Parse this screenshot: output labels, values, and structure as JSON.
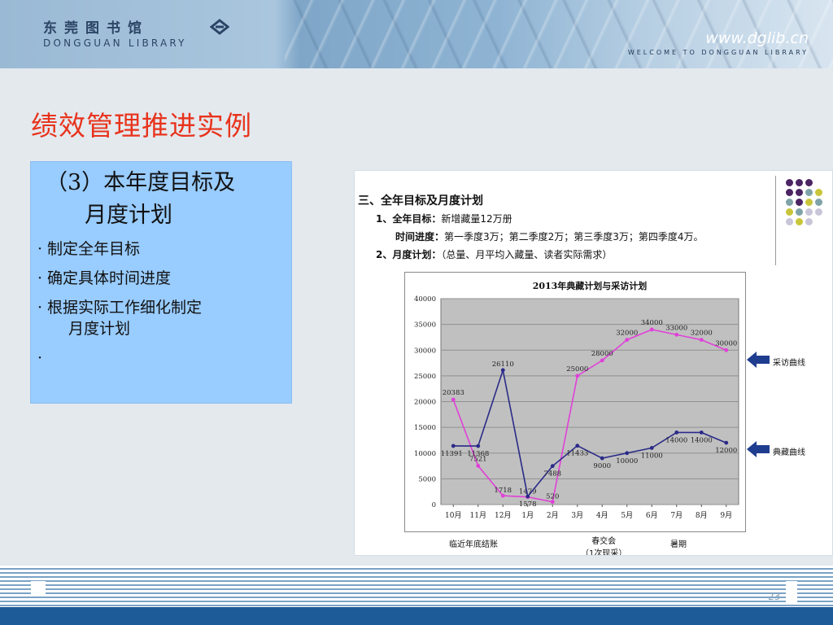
{
  "header": {
    "logo_cn": "东莞图书馆",
    "logo_en": "DONGGUAN LIBRARY",
    "site_url": "www.dglib.cn",
    "site_tagline": "WELCOME TO DONGGUAN LIBRARY"
  },
  "slide": {
    "title": "绩效管理推进实例",
    "page_number": "23"
  },
  "content_box": {
    "heading_line1": "（3）本年度目标及",
    "heading_line2": "月度计划",
    "bullets": [
      {
        "text": "制定全年目标"
      },
      {
        "text": "确定具体时间进度"
      },
      {
        "text": "根据实际工作细化制定",
        "text_cont": "月度计划"
      },
      {
        "text": ""
      }
    ]
  },
  "figure": {
    "heading": "三、全年目标及月度计划",
    "line1_label": "1、全年目标：",
    "line1_value": "新增藏量12万册",
    "line2_label": "时间进度：",
    "line2_value": "第一季度3万；第二季度2万；第三季度3万；第四季度4万。",
    "line3_label": "2、月度计划：",
    "line3_value": "（总量、月平均入藏量、读者实际需求）",
    "arrow_top_label": "采访曲线",
    "arrow_bottom_label": "典藏曲线",
    "period_labels": {
      "left": "临近年底结账",
      "middle_line1": "春交会",
      "middle_line2": "（1次现采）",
      "right": "暑期"
    },
    "dot_colors": [
      "#4b2563",
      "#7fa3a9",
      "#c9c63a",
      "#c8c6d8"
    ]
  },
  "chart_data": {
    "type": "line",
    "title": "2013年典藏计划与采访计划",
    "categories": [
      "10月",
      "11月",
      "12月",
      "1月",
      "2月",
      "3月",
      "4月",
      "5月",
      "6月",
      "7月",
      "8月",
      "9月"
    ],
    "ylim": [
      0,
      40000
    ],
    "yticks": [
      0,
      5000,
      10000,
      15000,
      20000,
      25000,
      30000,
      35000,
      40000
    ],
    "grid": true,
    "plot_background": "#c0c0c0",
    "series": [
      {
        "name": "采访曲线",
        "color": "#e040d8",
        "values": [
          20383,
          7521,
          1718,
          1479,
          520,
          25000,
          28000,
          32000,
          34000,
          33000,
          32000,
          30000
        ]
      },
      {
        "name": "典藏曲线",
        "color": "#2a2a88",
        "values": [
          11391,
          11368,
          26110,
          1578,
          7488,
          11433,
          9000,
          10000,
          11000,
          14000,
          14000,
          12000
        ]
      }
    ]
  }
}
